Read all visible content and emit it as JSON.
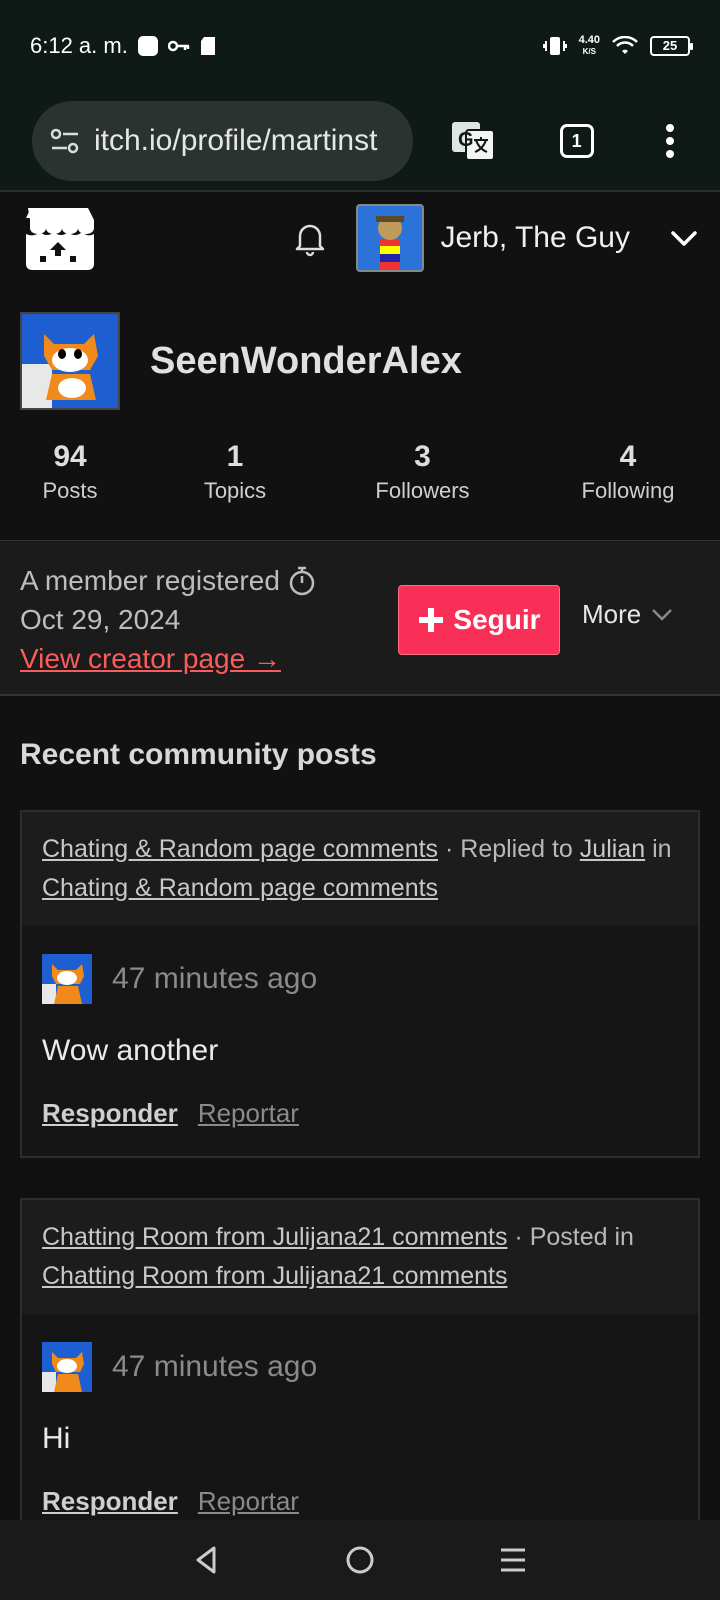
{
  "status_bar": {
    "time": "6:12 a. m.",
    "speed_value": "4.40",
    "speed_unit": "K/S",
    "battery": "25"
  },
  "browser": {
    "url": "itch.io/profile/martinst",
    "tab_count": "1"
  },
  "header": {
    "user_name": "Jerb, The Guy"
  },
  "profile": {
    "name": "SeenWonderAlex",
    "stats": [
      {
        "num": "94",
        "label": "Posts"
      },
      {
        "num": "1",
        "label": "Topics"
      },
      {
        "num": "3",
        "label": "Followers"
      },
      {
        "num": "4",
        "label": "Following"
      }
    ],
    "member_line": "A member registered",
    "member_date": "Oct 29, 2024",
    "creator_link": "View creator page →",
    "follow_label": "Seguir",
    "more_label": "More"
  },
  "section_title": "Recent community posts",
  "posts": [
    {
      "topic": "Chating & Random page comments",
      "action": " · Replied to ",
      "target": "Julian",
      "in_word": " in ",
      "board": "Chating & Random page comments",
      "time": "47 minutes ago",
      "text": "Wow another",
      "reply_label": "Responder",
      "report_label": "Reportar"
    },
    {
      "topic": "Chatting Room from Julijana21 comments",
      "action": " · Posted in",
      "target": "",
      "in_word": "",
      "board": "Chatting Room from Julijana21 comments",
      "time": "47 minutes ago",
      "text": "Hi",
      "reply_label": "Responder",
      "report_label": "Reportar"
    }
  ],
  "colors": {
    "accent": "#fa2f57",
    "link": "#fa5c5c",
    "background": "#111111"
  }
}
